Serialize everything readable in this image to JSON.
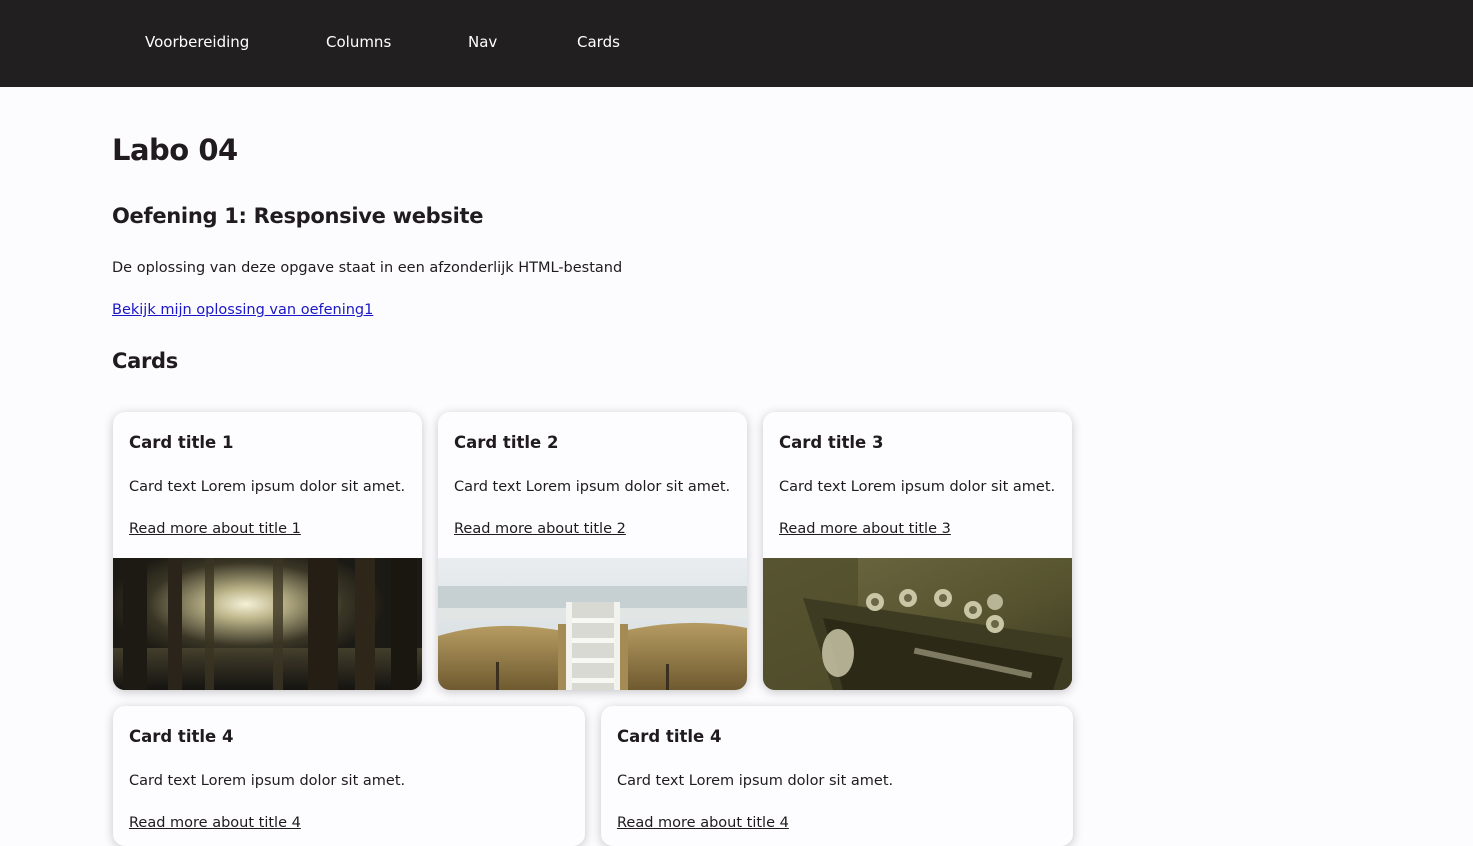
{
  "nav": {
    "items": [
      {
        "label": "Voorbereiding"
      },
      {
        "label": "Columns"
      },
      {
        "label": "Nav"
      },
      {
        "label": "Cards"
      }
    ]
  },
  "main": {
    "title": "Labo 04",
    "exercise_heading": "Oefening 1: Responsive website",
    "exercise_text": "De oplossing van deze opgave staat in een afzonderlijk HTML-bestand",
    "exercise_link": "Bekijk mijn oplossing van oefening1",
    "cards_heading": "Cards"
  },
  "cards": [
    {
      "title": "Card title 1",
      "text": "Card text Lorem ipsum dolor sit amet.",
      "link": "Read more about title 1",
      "image": "forest-photo"
    },
    {
      "title": "Card title 2",
      "text": "Card text Lorem ipsum dolor sit amet.",
      "link": "Read more about title 2",
      "image": "beach-stairs-photo"
    },
    {
      "title": "Card title 3",
      "text": "Card text Lorem ipsum dolor sit amet.",
      "link": "Read more about title 3",
      "image": "guitar-headstock-photo"
    },
    {
      "title": "Card title 4",
      "text": "Card text Lorem ipsum dolor sit amet.",
      "link": "Read more about title 4"
    },
    {
      "title": "Card title 4",
      "text": "Card text Lorem ipsum dolor sit amet.",
      "link": "Read more about title 4"
    }
  ],
  "colors": {
    "nav_bg": "#221f21",
    "page_bg": "#fcfbfd",
    "link": "#1b17c8",
    "text": "#1f1b1e"
  }
}
